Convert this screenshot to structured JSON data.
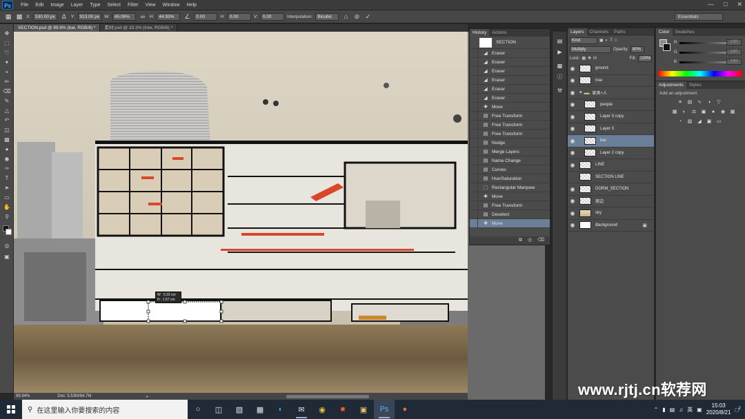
{
  "app": {
    "logo": "Ps",
    "menu": [
      "File",
      "Edit",
      "Image",
      "Layer",
      "Type",
      "Select",
      "Filter",
      "View",
      "Window",
      "Help"
    ]
  },
  "options_bar": {
    "x_label": "X:",
    "x_value": "530.00 px",
    "y_label": "Y:",
    "y_value": "913.00 px",
    "w_label": "W:",
    "w_value": "45.06%",
    "h_label": "H:",
    "h_value": "44.93%",
    "angle_value": "0.00",
    "hskew_label": "H:",
    "hskew_value": "0.00",
    "vskew_label": "V:",
    "vskew_value": "0.00",
    "interp_label": "Interpolation:",
    "interp_value": "Bicubic",
    "workspace": "Essentials"
  },
  "tabs": [
    {
      "label": "SECTION.psd @ 89.9% (bar, RGB/8) *",
      "active": true
    },
    {
      "label": "素材.psd @ 33.3% (tree, RGB/8) *",
      "active": false
    }
  ],
  "transform_readout": {
    "w": "W : 5.33 cm",
    "h": "H : 1.57 cm"
  },
  "status": {
    "zoom": "89.94%",
    "doc": "Doc: 5.53M/84.7M"
  },
  "history": {
    "tabs": [
      "History",
      "Actions"
    ],
    "snapshot": "SECTION",
    "items": [
      {
        "label": "Eraser",
        "icon": "eraser-icon"
      },
      {
        "label": "Eraser",
        "icon": "eraser-icon"
      },
      {
        "label": "Eraser",
        "icon": "eraser-icon"
      },
      {
        "label": "Eraser",
        "icon": "eraser-icon"
      },
      {
        "label": "Eraser",
        "icon": "eraser-icon"
      },
      {
        "label": "Eraser",
        "icon": "eraser-icon"
      },
      {
        "label": "Move",
        "icon": "move-icon"
      },
      {
        "label": "Free Transform",
        "icon": "doc-icon"
      },
      {
        "label": "Free Transform",
        "icon": "doc-icon"
      },
      {
        "label": "Free Transform",
        "icon": "doc-icon"
      },
      {
        "label": "Nudge",
        "icon": "doc-icon"
      },
      {
        "label": "Merge Layers",
        "icon": "doc-icon"
      },
      {
        "label": "Name Change",
        "icon": "doc-icon"
      },
      {
        "label": "Curves",
        "icon": "doc-icon"
      },
      {
        "label": "Hue/Saturation",
        "icon": "doc-icon"
      },
      {
        "label": "Rectangular Marquee",
        "icon": "marquee-icon"
      },
      {
        "label": "Move",
        "icon": "move-icon"
      },
      {
        "label": "Free Transform",
        "icon": "doc-icon"
      },
      {
        "label": "Deselect",
        "icon": "doc-icon"
      },
      {
        "label": "Move",
        "icon": "move-icon"
      }
    ]
  },
  "layers": {
    "tabs": [
      "Layers",
      "Channels",
      "Paths"
    ],
    "kind": "Kind",
    "blend": "Multiply",
    "opacity_label": "Opacity:",
    "opacity": "80%",
    "lock_label": "Lock:",
    "fill_label": "Fill:",
    "fill": "100%",
    "items": [
      {
        "name": "ground",
        "visible": true,
        "thumb": "checker",
        "indent": 0
      },
      {
        "name": "tree",
        "visible": true,
        "thumb": "checker",
        "indent": 0
      },
      {
        "name": "家具+人",
        "visible": true,
        "thumb": "folder",
        "indent": 0
      },
      {
        "name": "people",
        "visible": true,
        "thumb": "checker",
        "indent": 1
      },
      {
        "name": "Layer 3 copy",
        "visible": true,
        "thumb": "checker",
        "indent": 1
      },
      {
        "name": "Layer 3",
        "visible": true,
        "thumb": "checker",
        "indent": 1
      },
      {
        "name": "bar",
        "visible": true,
        "thumb": "checker",
        "indent": 1,
        "selected": true
      },
      {
        "name": "Layer 2 copy",
        "visible": true,
        "thumb": "checker",
        "indent": 1
      },
      {
        "name": "LINE",
        "visible": true,
        "thumb": "checker",
        "indent": 0
      },
      {
        "name": "SECTION LINE",
        "visible": false,
        "thumb": "checker",
        "indent": 0
      },
      {
        "name": "DORM_SECTION",
        "visible": true,
        "thumb": "checker",
        "indent": 0
      },
      {
        "name": "周边",
        "visible": true,
        "thumb": "checker",
        "indent": 0
      },
      {
        "name": "sky",
        "visible": true,
        "thumb": "sky",
        "indent": 0
      },
      {
        "name": "Background",
        "visible": true,
        "thumb": "white",
        "indent": 0,
        "locked": true
      }
    ]
  },
  "color": {
    "tabs": [
      "Color",
      "Swatches"
    ],
    "r_label": "R",
    "r": "130",
    "g_label": "G",
    "g": "140",
    "b_label": "B",
    "b": "140"
  },
  "adjustments": {
    "tabs": [
      "Adjustments",
      "Styles"
    ],
    "hint": "Add an adjustment"
  },
  "taskbar": {
    "search_placeholder": "在这里输入你要搜索的内容",
    "time": "15:03",
    "date": "2020/8/21",
    "ime": "英",
    "notify_count": "2"
  },
  "watermark": "www.rjtj.cn软荐网",
  "colors": {
    "selection": "#6c7f99",
    "accent_orange": "#d8472a",
    "sky_paper": "#d9d2c2",
    "ground": "#7d6a4c"
  }
}
